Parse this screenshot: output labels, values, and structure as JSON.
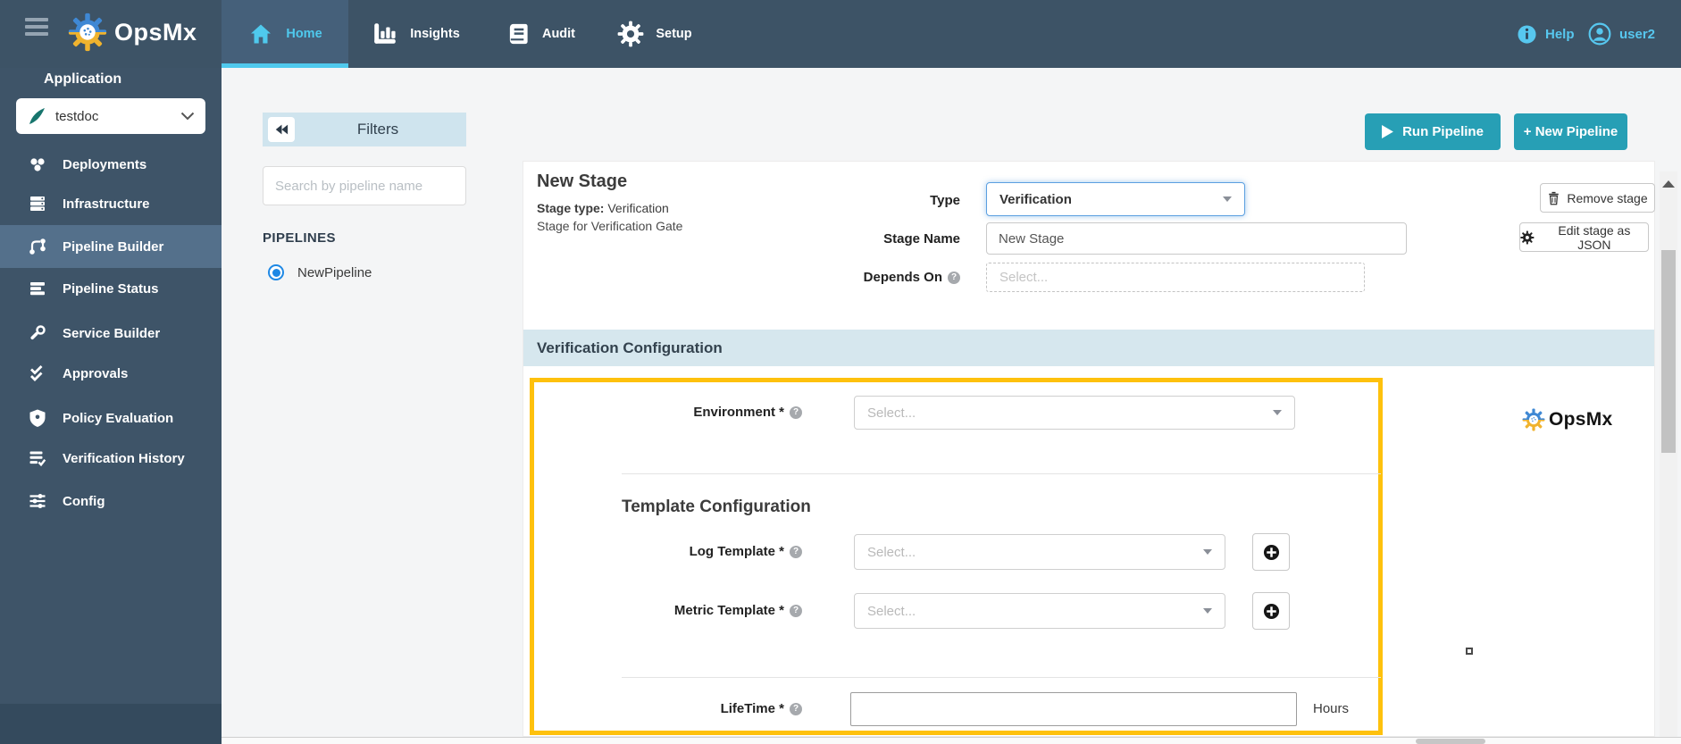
{
  "topbar": {
    "brand": "OpsMx",
    "tabs": [
      {
        "label": "Home",
        "active": true
      },
      {
        "label": "Insights",
        "active": false
      },
      {
        "label": "Audit",
        "active": false
      },
      {
        "label": "Setup",
        "active": false
      }
    ],
    "help_label": "Help",
    "username": "user2"
  },
  "sidebar": {
    "section_label": "Application",
    "app_selector_value": "testdoc",
    "items": [
      {
        "label": "Deployments",
        "active": false
      },
      {
        "label": "Infrastructure",
        "active": false
      },
      {
        "label": "Pipeline Builder",
        "active": true
      },
      {
        "label": "Pipeline Status",
        "active": false
      },
      {
        "label": "Service Builder",
        "active": false
      },
      {
        "label": "Approvals",
        "active": false
      },
      {
        "label": "Policy Evaluation",
        "active": false
      },
      {
        "label": "Verification History",
        "active": false
      },
      {
        "label": "Config",
        "active": false
      }
    ]
  },
  "pipelines_panel": {
    "filters_label": "Filters",
    "search_placeholder": "Search by pipeline name",
    "section_title": "PIPELINES",
    "pipelines": [
      {
        "name": "NewPipeline",
        "selected": true
      }
    ]
  },
  "actions": {
    "run_pipeline_label": "Run Pipeline",
    "new_pipeline_label": "+ New Pipeline"
  },
  "stage_editor": {
    "title": "New Stage",
    "stage_type_label": "Stage type:",
    "stage_type_value": "Verification",
    "description": "Stage for Verification Gate",
    "fields": {
      "type_label": "Type",
      "type_value": "Verification",
      "stage_name_label": "Stage Name",
      "stage_name_value": "New Stage",
      "depends_on_label": "Depends On",
      "depends_on_placeholder": "Select..."
    },
    "remove_stage_label": "Remove stage",
    "edit_json_label": "Edit stage as JSON"
  },
  "verification_config": {
    "section_title": "Verification Configuration",
    "environment_label": "Environment *",
    "environment_placeholder": "Select...",
    "template_section_title": "Template Configuration",
    "log_template_label": "Log Template *",
    "log_template_placeholder": "Select...",
    "metric_template_label": "Metric Template *",
    "metric_template_placeholder": "Select...",
    "lifetime_label": "LifeTime *",
    "lifetime_value": "",
    "lifetime_unit": "Hours",
    "watermark": "OpsMx"
  },
  "colors": {
    "topbar_bg": "#3d5366",
    "sidebar_bg": "#3e5468",
    "active_item_bg": "#54708b",
    "accent_cyan": "#4fc9ed",
    "button_teal": "#279fb5",
    "band_blue": "#d6e7ee",
    "highlight_yellow": "#fec10d"
  }
}
